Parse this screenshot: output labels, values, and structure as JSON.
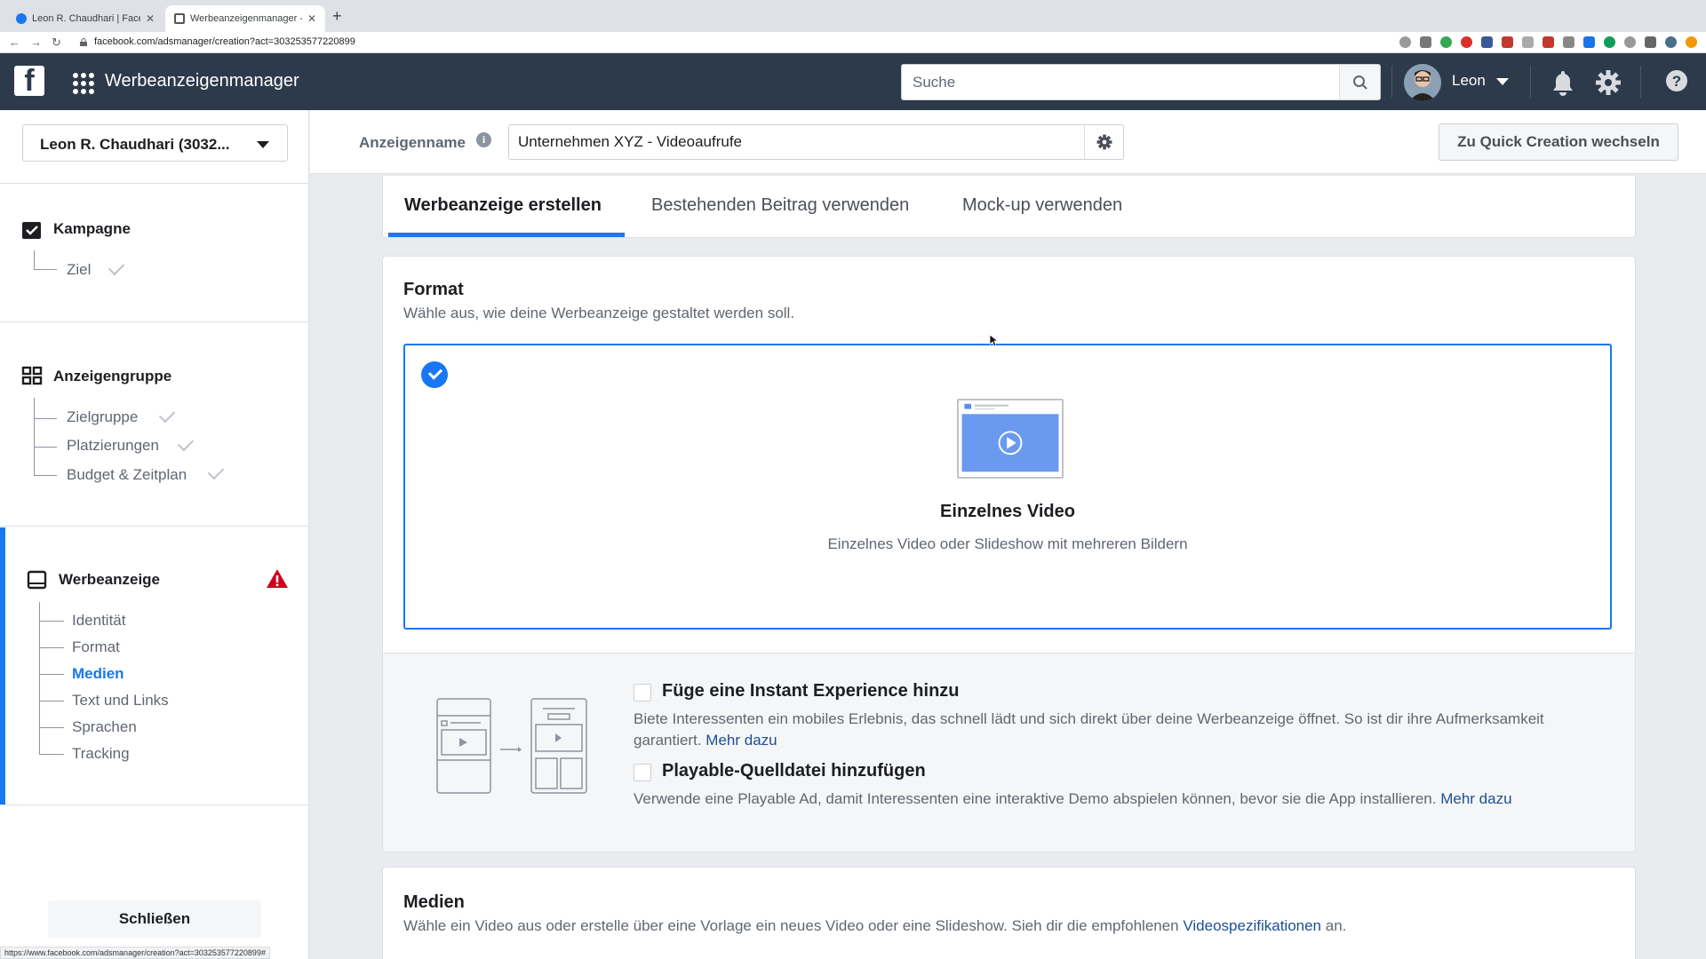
{
  "browser": {
    "tabs": [
      {
        "label": "Leon R. Chaudhari | Facebook"
      },
      {
        "label": "Werbeanzeigenmanager - Cre..."
      }
    ],
    "new_tab": "+",
    "url": "facebook.com/adsmanager/creation?act=303253577220899",
    "status_url": "https://www.facebook.com/adsmanager/creation?act=303253577220899#"
  },
  "header": {
    "logo": "f",
    "app_title": "Werbeanzeigenmanager",
    "search_placeholder": "Suche",
    "username": "Leon"
  },
  "sidebar": {
    "account": "Leon R. Chaudhari (3032...",
    "sections": [
      {
        "title": "Kampagne",
        "items": [
          "Ziel"
        ]
      },
      {
        "title": "Anzeigengruppe",
        "items": [
          "Zielgruppe",
          "Platzierungen",
          "Budget & Zeitplan"
        ]
      },
      {
        "title": "Werbeanzeige",
        "items": [
          "Identität",
          "Format",
          "Medien",
          "Text und Links",
          "Sprachen",
          "Tracking"
        ]
      }
    ],
    "close_label": "Schließen"
  },
  "namebar": {
    "label": "Anzeigenname",
    "info": "i",
    "value": "Unternehmen XYZ - Videoaufrufe",
    "quick_button": "Zu Quick Creation wechseln"
  },
  "tabs": [
    {
      "label": "Werbeanzeige erstellen"
    },
    {
      "label": "Bestehenden Beitrag verwenden"
    },
    {
      "label": "Mock-up verwenden"
    }
  ],
  "format": {
    "title": "Format",
    "subtitle": "Wähle aus, wie deine Werbeanzeige gestaltet werden soll.",
    "option_title": "Einzelnes Video",
    "option_sub": "Einzelnes Video oder Slideshow mit mehreren Bildern",
    "instant": {
      "title": "Füge eine Instant Experience hinzu",
      "desc": "Biete Interessenten ein mobiles Erlebnis, das schnell lädt und sich direkt über deine Werbeanzeige öffnet. So ist dir ihre Aufmerksamkeit garantiert.",
      "link": "Mehr dazu"
    },
    "playable": {
      "title": "Playable-Quelldatei hinzufügen",
      "desc": "Verwende eine Playable Ad, damit Interessenten eine interaktive Demo abspielen können, bevor sie die App installieren.",
      "link": "Mehr dazu"
    }
  },
  "media": {
    "title": "Medien",
    "subtitle": "Wähle ein Video aus oder erstelle über eine Vorlage ein neues Video oder eine Slideshow. Sieh dir die empfohlenen",
    "link": "Videospezifikationen",
    "suffix": "an."
  },
  "colors": {
    "accent": "#1877f2",
    "header_bg": "#2c3a4b",
    "warning": "#d0021b"
  }
}
